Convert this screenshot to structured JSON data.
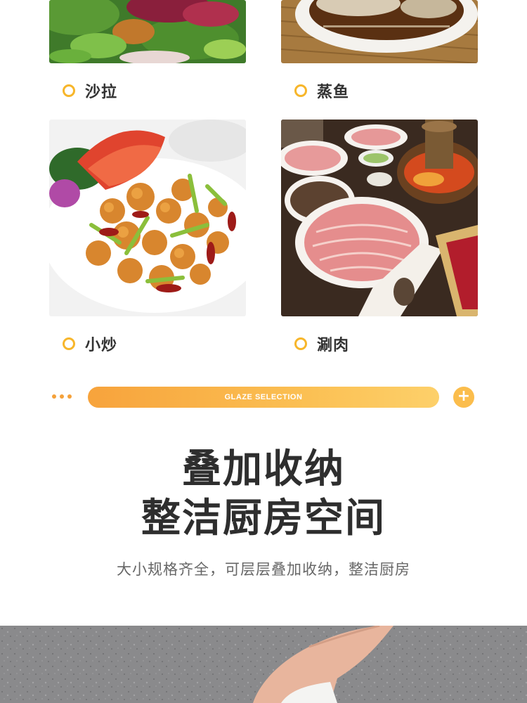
{
  "items": [
    {
      "label": "沙拉",
      "image": "salad-photo"
    },
    {
      "label": "蒸鱼",
      "image": "steamed-fish-photo"
    },
    {
      "label": "小炒",
      "image": "stir-fry-photo"
    },
    {
      "label": "涮肉",
      "image": "hotpot-photo"
    }
  ],
  "banner": {
    "text": "GLAZE SELECTION",
    "plus_icon": "+"
  },
  "headline": {
    "line1": "叠加收纳",
    "line2": "整洁厨房空间"
  },
  "subtitle": "大小规格齐全，可层层叠加收纳，整洁厨房",
  "colors": {
    "accent": "#f7b62b",
    "pill_start": "#f7a33c",
    "pill_end": "#fdd06a",
    "stone": "#8a8a8c"
  }
}
